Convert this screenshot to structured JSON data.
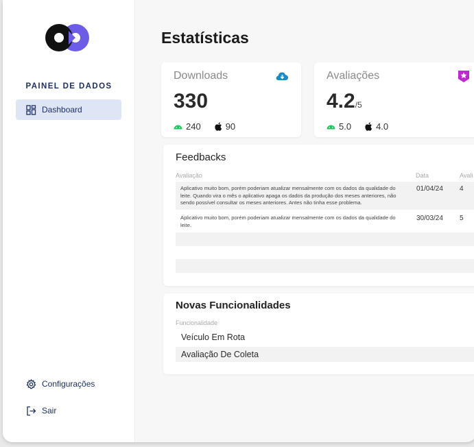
{
  "sidebar": {
    "brand": "PAINEL DE DADOS",
    "items": [
      {
        "label": "Dashboard",
        "icon": "dashboard-icon"
      },
      {
        "label": "Configurações",
        "icon": "gear-icon"
      },
      {
        "label": "Sair",
        "icon": "logout-icon"
      }
    ]
  },
  "page": {
    "title": "Estatísticas"
  },
  "stats": {
    "downloads": {
      "label": "Downloads",
      "value": "330",
      "icon": "download-cloud-icon",
      "android": "240",
      "ios": "90"
    },
    "ratings": {
      "label": "Avaliações",
      "value": "4.2",
      "unit": "/5",
      "icon": "star-badge-icon",
      "android": "5.0",
      "ios": "4.0"
    }
  },
  "feedbacks": {
    "title": "Feedbacks",
    "columns": [
      "Avaliação",
      "Data",
      "Avali"
    ],
    "rows": [
      {
        "text": "Aplicativo muito bom, porém poderiam atualizar mensalmente com os dados da qualidade do leite. Quando vira o mês o aplicativo apaga os dados da produção dos meses anteriores, não sendo possível consultar os meses anteriores. Antes não tinha esse problema.",
        "date": "01/04/24",
        "score": "4"
      },
      {
        "text": "Aplicativo muito bom, porém poderiam atualizar mensalmente com os dados da qualidade do leite.",
        "date": "30/03/24",
        "score": "5"
      }
    ]
  },
  "features": {
    "title": "Novas Funcionalidades",
    "column": "Funcionalidade",
    "rows": [
      "Veículo Em Rota",
      "Avaliação De Coleta"
    ]
  },
  "colors": {
    "accent": "#1e2f63",
    "active_bg": "#dee5f5",
    "download_icon": "#1e88c7",
    "star_icon": "#c026d3",
    "android": "#22c55e",
    "logo_purple": "#6c5ce7"
  }
}
